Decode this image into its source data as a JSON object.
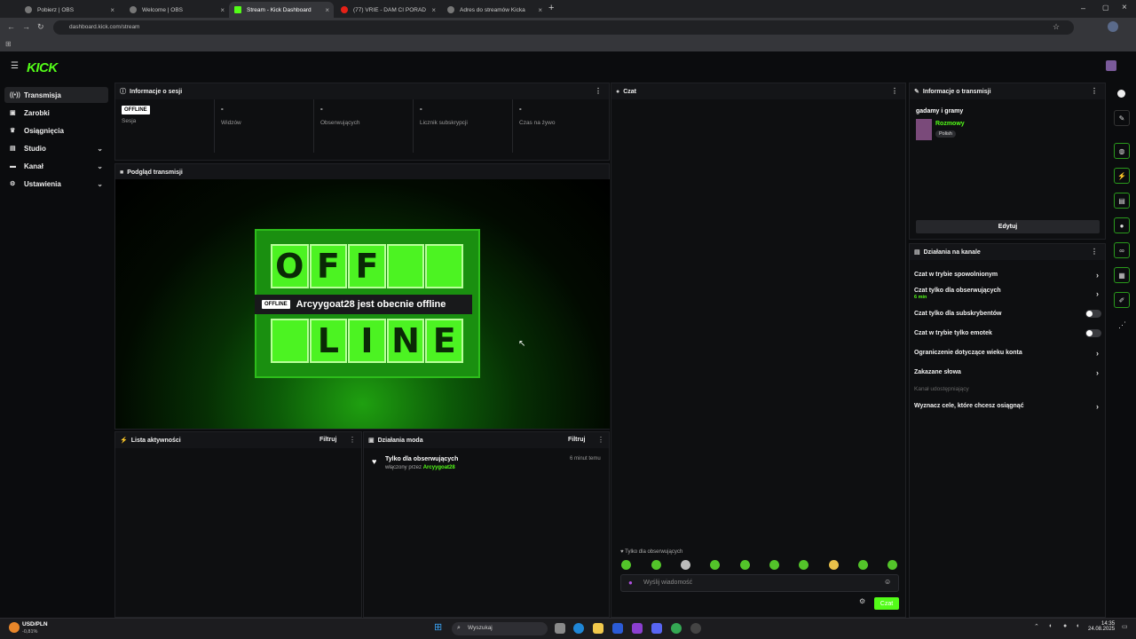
{
  "browser": {
    "tabs": [
      {
        "label": "Pobierz | OBS"
      },
      {
        "label": "Welcome | OBS"
      },
      {
        "label": "Stream - Kick Dashboard"
      },
      {
        "label": "(77) VRIE - DAM CI PORAD"
      },
      {
        "label": "Adres do streamów Kicka"
      }
    ],
    "url": "dashboard.kick.com/stream"
  },
  "brand": {
    "logo": "KICK",
    "accent": "#53fc18"
  },
  "sidebar": {
    "items": [
      {
        "label": "Transmisja",
        "icon": "broadcast-icon"
      },
      {
        "label": "Zarobki",
        "icon": "wallet-icon"
      },
      {
        "label": "Osiągnięcia",
        "icon": "trophy-icon"
      },
      {
        "label": "Studio",
        "icon": "studio-icon"
      },
      {
        "label": "Kanał",
        "icon": "channel-icon"
      },
      {
        "label": "Ustawienia",
        "icon": "gear-icon"
      }
    ]
  },
  "session": {
    "title": "Informacje o sesji",
    "badge": "OFFLINE",
    "stats": [
      {
        "value": "",
        "label": "Sesja"
      },
      {
        "value": "-",
        "label": "Widzów"
      },
      {
        "value": "-",
        "label": "Obserwujących"
      },
      {
        "value": "-",
        "label": "Licznik subskrypcji"
      },
      {
        "value": "-",
        "label": "Czas na żywo"
      }
    ]
  },
  "preview": {
    "title": "Podgląd transmisji",
    "badge": "OFFLINE",
    "message": "Arcyygoat28 jest obecnie offline",
    "sign_top": [
      "O",
      "F",
      "F",
      "",
      ""
    ],
    "sign_bottom": [
      "",
      "L",
      "I",
      "N",
      "E"
    ]
  },
  "activity": {
    "title": "Lista aktywności",
    "filter": "Filtruj"
  },
  "mod": {
    "title": "Działania moda",
    "filter": "Filtruj",
    "entry_title": "Tylko dla obserwujących",
    "entry_prefix": "włączony przez",
    "entry_user": "Arcyygoat28",
    "entry_time": "6 minut temu"
  },
  "chat": {
    "title": "Czat",
    "followers_only": "Tylko dla obserwujących",
    "placeholder": "Wyślij wiadomość",
    "send": "Czat"
  },
  "stream_info": {
    "title": "Informacje o transmisji",
    "stream_title": "gadamy i gramy",
    "category": "Rozmowy",
    "tag": "Polish",
    "edit": "Edytuj"
  },
  "channel_actions": {
    "title": "Działania na kanale",
    "items": [
      {
        "label": "Czat w trybie spowolnionym",
        "sub": ""
      },
      {
        "label": "Czat tylko dla obserwujących",
        "sub": "6 min"
      },
      {
        "label": "Czat tylko dla subskrybentów",
        "sub": ""
      },
      {
        "label": "Czat w trybie tylko emotek",
        "sub": ""
      },
      {
        "label": "Ograniczenie dotyczące wieku konta",
        "sub": ""
      },
      {
        "label": "Zakazane słowa",
        "sub": ""
      },
      {
        "label": "Kanał udostępniający",
        "sub": ""
      },
      {
        "label": "Wyznacz cele, które chcesz osiągnąć",
        "sub": ""
      }
    ]
  },
  "taskbar": {
    "ticker": "USD/PLN",
    "ticker_change": "-0,81%",
    "search": "Wyszukaj",
    "time": "14:35",
    "date": "24.08.2025"
  }
}
